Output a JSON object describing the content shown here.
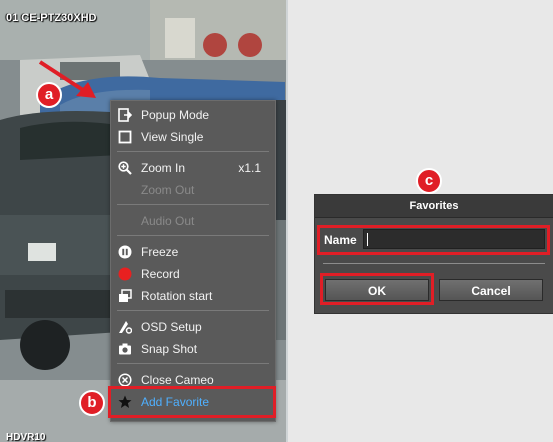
{
  "camera": {
    "title": "01 CE-PTZ30XHD",
    "bottom_label": "HDVR10"
  },
  "context_menu": {
    "items": [
      {
        "id": "popup-mode",
        "label": "Popup Mode",
        "icon": "popup-icon",
        "enabled": true
      },
      {
        "id": "view-single",
        "label": "View Single",
        "icon": "square-icon",
        "enabled": true
      },
      {
        "id": "zoom-in",
        "label": "Zoom In",
        "icon": "zoom-in-icon",
        "shortcut": "x1.1",
        "enabled": true
      },
      {
        "id": "zoom-out",
        "label": "Zoom Out",
        "icon": "",
        "enabled": false
      },
      {
        "id": "audio-out",
        "label": "Audio Out",
        "icon": "",
        "enabled": false
      },
      {
        "id": "freeze",
        "label": "Freeze",
        "icon": "pause-icon",
        "enabled": true
      },
      {
        "id": "record",
        "label": "Record",
        "icon": "record-icon",
        "enabled": true
      },
      {
        "id": "rotation-start",
        "label": "Rotation start",
        "icon": "rotation-icon",
        "enabled": true
      },
      {
        "id": "osd-setup",
        "label": "OSD Setup",
        "icon": "osd-icon",
        "enabled": true
      },
      {
        "id": "snap-shot",
        "label": "Snap Shot",
        "icon": "camera-icon",
        "enabled": true
      },
      {
        "id": "close-cameo",
        "label": "Close Cameo",
        "icon": "close-circle-icon",
        "enabled": true
      },
      {
        "id": "add-favorite",
        "label": "Add Favorite",
        "icon": "star-icon",
        "enabled": true,
        "highlighted": true
      }
    ]
  },
  "callouts": {
    "a": "a",
    "b": "b",
    "c": "c"
  },
  "favorites_dialog": {
    "title": "Favorites",
    "name_label": "Name",
    "name_value": "",
    "ok_label": "OK",
    "cancel_label": "Cancel"
  },
  "colors": {
    "callout_red": "#e01e26",
    "highlight_text": "#4fb0ff",
    "menu_bg": "#5a5a5a",
    "dialog_bg": "#4a4a4a"
  }
}
